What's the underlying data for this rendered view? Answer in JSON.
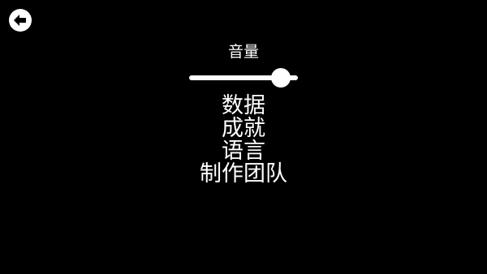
{
  "header": {
    "back_icon": "back-arrow-icon"
  },
  "settings": {
    "volume_label": "音量",
    "volume_level": 0.84
  },
  "menu": {
    "items": [
      {
        "label": "数据"
      },
      {
        "label": "成就"
      },
      {
        "label": "语言"
      },
      {
        "label": "制作团队"
      }
    ]
  },
  "colors": {
    "background": "#000000",
    "foreground": "#ffffff"
  }
}
